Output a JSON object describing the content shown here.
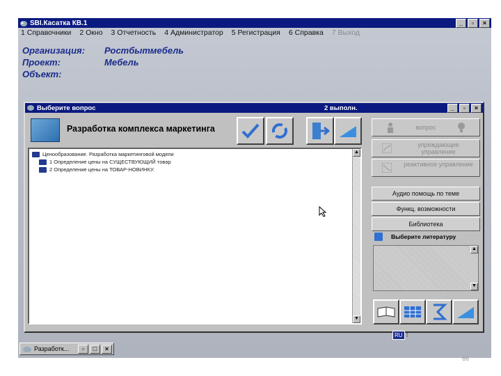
{
  "app": {
    "title": "SBI.Касатка КВ.1",
    "menu": [
      "1 Справочники",
      "2 Окно",
      "3 Отчетность",
      "4 Администратор",
      "5 Регистрация",
      "6 Справка",
      "7 Выход"
    ]
  },
  "info": {
    "rows": [
      {
        "label": "Организация:",
        "value": "Ростбытмебель"
      },
      {
        "label": "Проект:",
        "value": "Мебель"
      },
      {
        "label": "Объект:",
        "value": ""
      }
    ]
  },
  "dialog": {
    "title": "Выберите вопрос",
    "count": "2 выполн.",
    "header_title": "Разработка комплекса маркетинга",
    "tree": {
      "root": "Ценообразование. Разработка маркетинговой модели",
      "items": [
        "1  Определение цены на СУЩЕСТВУЮЩИЙ товар",
        "2  Определение цены на ТОВАР-НОВИНКУ."
      ]
    },
    "right": {
      "question_label": "вопрос",
      "btn1": "упреждающее управление",
      "btn2": "реактивное управление",
      "options": [
        "Аудио помощь по теме",
        "Функц. возможности",
        "Библиотека"
      ],
      "lit_label": "Выберите литературу"
    }
  },
  "taskbar": {
    "item": "Разработк...",
    "lang": "RU"
  },
  "page_number": "66"
}
